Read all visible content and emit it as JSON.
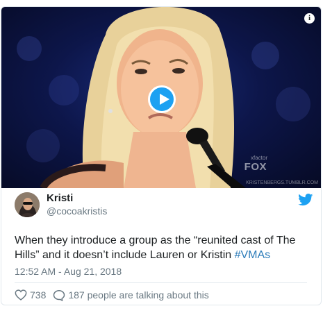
{
  "media": {
    "info_symbol": "i",
    "play_icon": "play-icon",
    "channel_brand": "FOX",
    "show_mark": "xfactor",
    "watermark": "KRISTENBERGS.TUMBLR.COM"
  },
  "tweet": {
    "display_name": "Kristi",
    "handle": "@cocoakristis",
    "text_main": "When they introduce a group as the “reunited cast of The Hills” and it doesn’t include Lauren or Kristin ",
    "hashtag": "#VMAs",
    "timestamp": "12:52 AM - Aug 21, 2018",
    "likes": "738",
    "talking": "187 people are talking about this"
  },
  "colors": {
    "accent": "#1da1f2",
    "hashtag": "#2b7bb9",
    "muted": "#697882",
    "text": "#1c2022"
  },
  "icons": [
    "info-icon",
    "play-icon",
    "twitter-bird-icon",
    "heart-icon",
    "reply-bubble-icon"
  ]
}
